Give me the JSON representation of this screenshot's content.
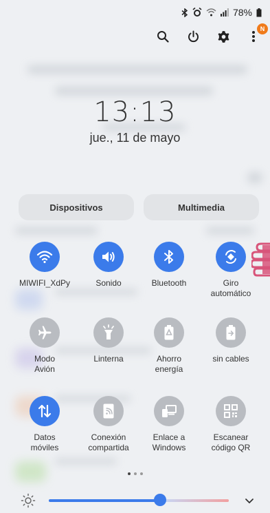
{
  "status_bar": {
    "battery_text": "78%",
    "icons": [
      "bluetooth-icon",
      "alarm-icon",
      "wifi-signal-icon",
      "cell-signal-icon",
      "battery-icon"
    ]
  },
  "top_actions": {
    "icons": [
      "search-icon",
      "power-icon",
      "gear-icon",
      "more-options-icon"
    ],
    "badge": "N"
  },
  "clock": {
    "time": "13:13",
    "date": "jue., 11 de mayo"
  },
  "pills": {
    "devices": "Dispositivos",
    "media": "Multimedia"
  },
  "tiles": [
    {
      "label": "MIWIFI_XdPy",
      "icon": "wifi-icon",
      "state": "on"
    },
    {
      "label": "Sonido",
      "icon": "sound-icon",
      "state": "on"
    },
    {
      "label": "Bluetooth",
      "icon": "bluetooth-icon",
      "state": "on"
    },
    {
      "label": "Giro\nautomático",
      "icon": "auto-rotate-icon",
      "state": "on"
    },
    {
      "label": "Modo\nAvión",
      "icon": "airplane-icon",
      "state": "off"
    },
    {
      "label": "Linterna",
      "icon": "flashlight-icon",
      "state": "off"
    },
    {
      "label": "Ahorro\nenergía",
      "icon": "power-saving-icon",
      "state": "off"
    },
    {
      "label": "sin cables",
      "icon": "wireless-share-icon",
      "state": "off"
    },
    {
      "label": "Datos\nmóviles",
      "icon": "mobile-data-icon",
      "state": "on"
    },
    {
      "label": "Conexión\ncompartida",
      "icon": "hotspot-icon",
      "state": "off"
    },
    {
      "label": "Enlace a\nWindows",
      "icon": "link-to-windows-icon",
      "state": "off"
    },
    {
      "label": "Escanear\ncódigo QR",
      "icon": "qr-scan-icon",
      "state": "off"
    }
  ],
  "pager": {
    "pages": 3,
    "active": 0
  },
  "brightness": {
    "level": 0.62
  },
  "colors": {
    "accent": "#3b7bea",
    "inactive": "#b9bcc1",
    "badge": "#f07b1b"
  }
}
